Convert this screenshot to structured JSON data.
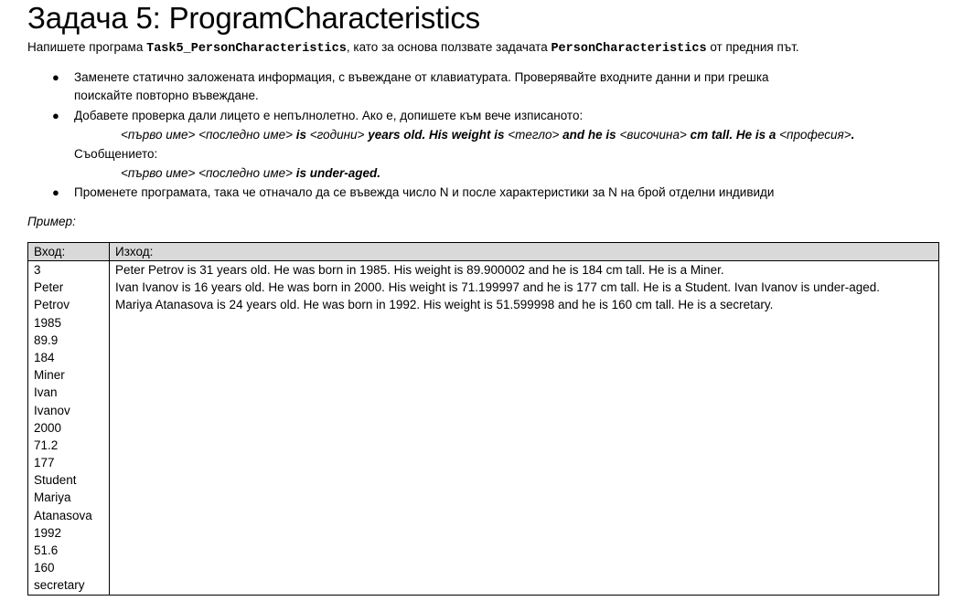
{
  "title": "Задача 5: ProgramCharacteristics",
  "intro": {
    "pre": "Напишете програма ",
    "code1": "Task5_PersonCharacteristics",
    "mid": ", като за основа ползвате задачата ",
    "code2": "PersonCharacteristics",
    "post": " от предния път."
  },
  "bullets": {
    "b1_line1": "Заменете статично заложената информация, с въвеждане от клавиатурата. Проверявайте входните данни и при грешка",
    "b1_line2": "поискайте повторно въвеждане.",
    "b2_line1": "Добавете проверка дали лицето е непълнолетно. Ако е, допишете към вече изписаното:",
    "b2_template": {
      "p1": "<първо име> <последно име> ",
      "p2": "is ",
      "p3": "<години>",
      "p4": " years old. His weight is ",
      "p5": "<тегло>",
      "p6": " and he is ",
      "p7": "<височина>",
      "p8": " cm tall. He is a ",
      "p9": "<професия>",
      "p10": "."
    },
    "b2_msg_label": "Съобщението:",
    "b2_msg": {
      "p1": "<първо име> <последно име> ",
      "p2": "is under-aged."
    },
    "b3": "Променете програмата, така че отначало да се въвежда число N и после характеристики за N на брой отделни индивиди"
  },
  "example_label": "Пример:",
  "table": {
    "input_header": "Вход:",
    "output_header": "Изход:",
    "input_lines": [
      "3",
      "Peter",
      "Petrov",
      "1985",
      "89.9",
      "184",
      "Miner",
      "Ivan",
      "Ivanov",
      "2000",
      "71.2",
      "177",
      "Student",
      "Mariya",
      "Atanasova",
      "1992",
      "51.6",
      "160",
      "secretary"
    ],
    "output_lines": [
      "Peter Petrov is 31 years old. He was born in 1985. His weight is 89.900002 and he is 184 cm tall. He is a Miner.",
      "Ivan Ivanov is 16 years old. He was born in 2000. His weight is 71.199997 and he is 177 cm tall. He is a Student. Ivan Ivanov is under-aged.",
      "Mariya Atanasova is 24 years old. He was born in 1992. His weight is 51.599998 and he is 160 cm tall. He is a secretary."
    ]
  }
}
